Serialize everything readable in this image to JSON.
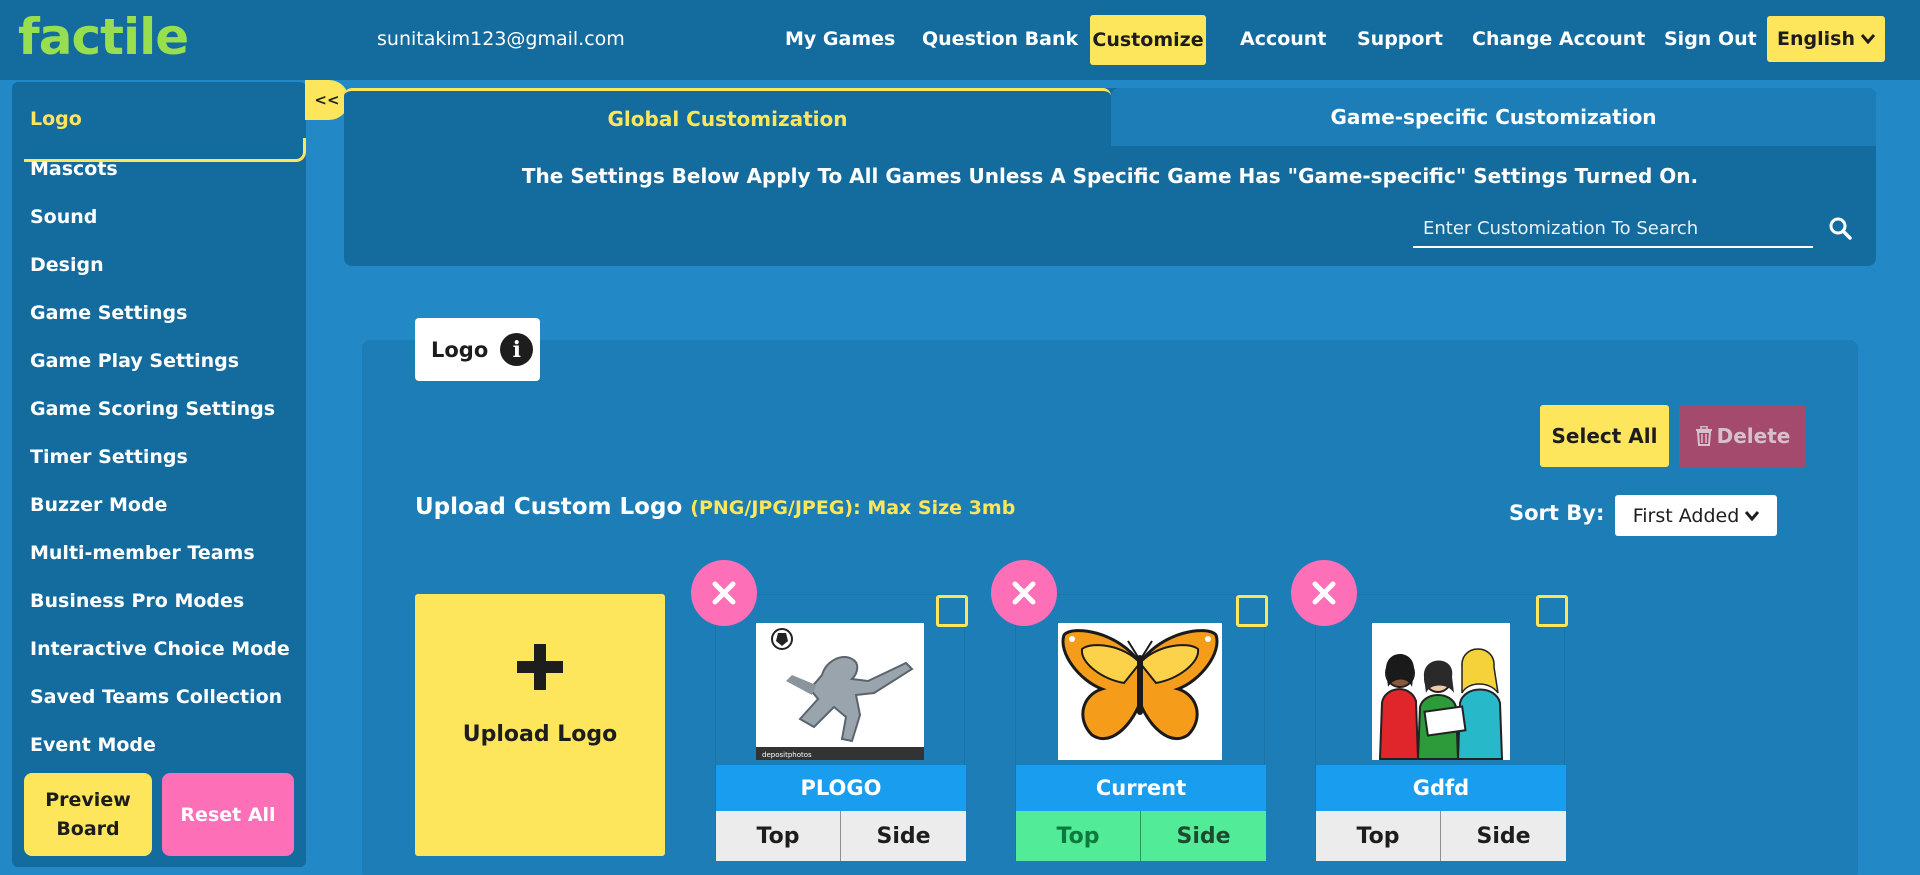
{
  "app": {
    "brand": "factile",
    "user_email": "sunitakim123@gmail.com"
  },
  "nav": {
    "links": [
      "My Games",
      "Question Bank",
      "Customize",
      "Account",
      "Support",
      "Change Account",
      "Sign Out"
    ],
    "active": "Customize",
    "language": "English"
  },
  "sidebar": {
    "items": [
      "Logo",
      "Mascots",
      "Sound",
      "Design",
      "Game Settings",
      "Game Play Settings",
      "Game Scoring Settings",
      "Timer Settings",
      "Buzzer Mode",
      "Multi-member Teams",
      "Business Pro Modes",
      "Interactive Choice Mode",
      "Saved Teams Collection",
      "Event Mode"
    ],
    "active_item": "Logo",
    "collapse_label": "<<",
    "preview_label": "Preview Board",
    "reset_label": "Reset All"
  },
  "tabs": {
    "global": "Global Customization",
    "game_specific": "Game-specific Customization",
    "note": "The Settings Below Apply To All Games Unless A Specific Game Has \"Game-specific\" Settings Turned On."
  },
  "search": {
    "placeholder": "Enter Customization To Search"
  },
  "section": {
    "title": "Logo",
    "select_all_label": "Select All",
    "delete_label": "Delete",
    "upload_title": "Upload Custom Logo",
    "upload_hint": "(PNG/JPG/JPEG): Max Size 3mb",
    "sort_label": "Sort By:",
    "sort_value": "First Added",
    "upload_tile_label": "Upload Logo"
  },
  "logos": [
    {
      "name": "PLOGO",
      "top_label": "Top",
      "side_label": "Side",
      "selected": false,
      "image": "soccer-player-icon"
    },
    {
      "name": "Current",
      "top_label": "Top",
      "side_label": "Side",
      "selected": true,
      "image": "butterfly-icon"
    },
    {
      "name": "Gdfd",
      "top_label": "Top",
      "side_label": "Side",
      "selected": false,
      "image": "women-group-icon"
    }
  ],
  "colors": {
    "accent_yellow": "#fde55c",
    "brand_green": "#97df4f",
    "pink": "#fd6fb6",
    "selected_green": "#52eb98",
    "nav_blue": "#146b9e",
    "bg_blue": "#2389c6"
  }
}
